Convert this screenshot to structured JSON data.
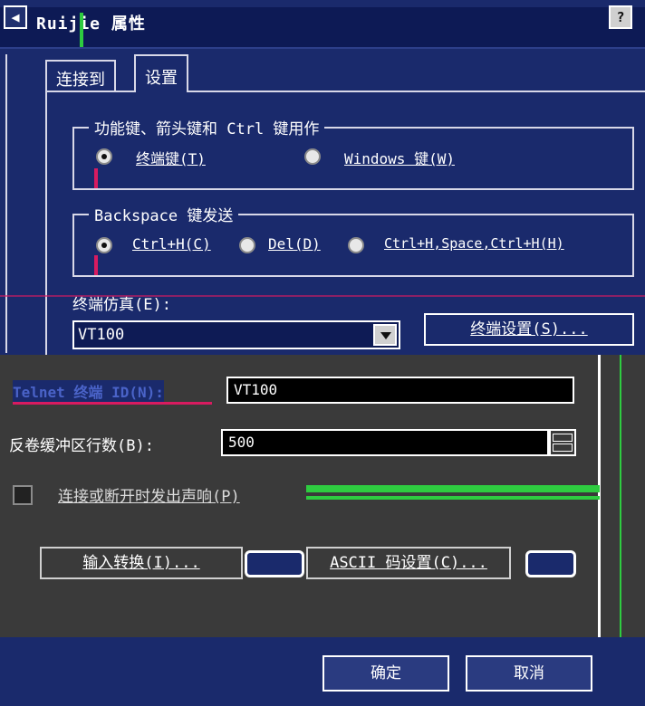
{
  "window": {
    "title": "Ruijie 属性",
    "help_button": "?",
    "system_menu_icon": "system-menu-icon"
  },
  "tabs": [
    {
      "label": "连接到",
      "selected": false
    },
    {
      "label": "设置",
      "selected": true
    }
  ],
  "function_keys_group": {
    "legend": "功能键、箭头键和 Ctrl 键用作",
    "options": [
      {
        "label": "终端键(T)",
        "selected": true
      },
      {
        "label": "Windows 键(W)",
        "selected": false
      }
    ]
  },
  "backspace_group": {
    "legend": "Backspace 键发送",
    "options": [
      {
        "label": "Ctrl+H(C)",
        "selected": true
      },
      {
        "label": "Del(D)",
        "selected": false
      },
      {
        "label": "Ctrl+H,Space,Ctrl+H(H)",
        "selected": false
      }
    ]
  },
  "emulation": {
    "label": "终端仿真(E):",
    "selected_value": "VT100",
    "settings_button": "终端设置(S)..."
  },
  "telnet": {
    "label": "Telnet 终端 ID(N):",
    "value": "VT100"
  },
  "backscroll": {
    "label": "反卷缓冲区行数(B):",
    "value": "500"
  },
  "beep": {
    "label": "连接或断开时发出声响(P)",
    "checked": false
  },
  "buttons": {
    "input_translation": "输入转换(I)...",
    "ascii_setup": "ASCII 码设置(C)...",
    "ok": "确定",
    "cancel": "取消"
  },
  "colors": {
    "dialog_bg": "#1a2a6c",
    "glitch_pink": "#d81b60",
    "glitch_green": "#2ecc40"
  }
}
